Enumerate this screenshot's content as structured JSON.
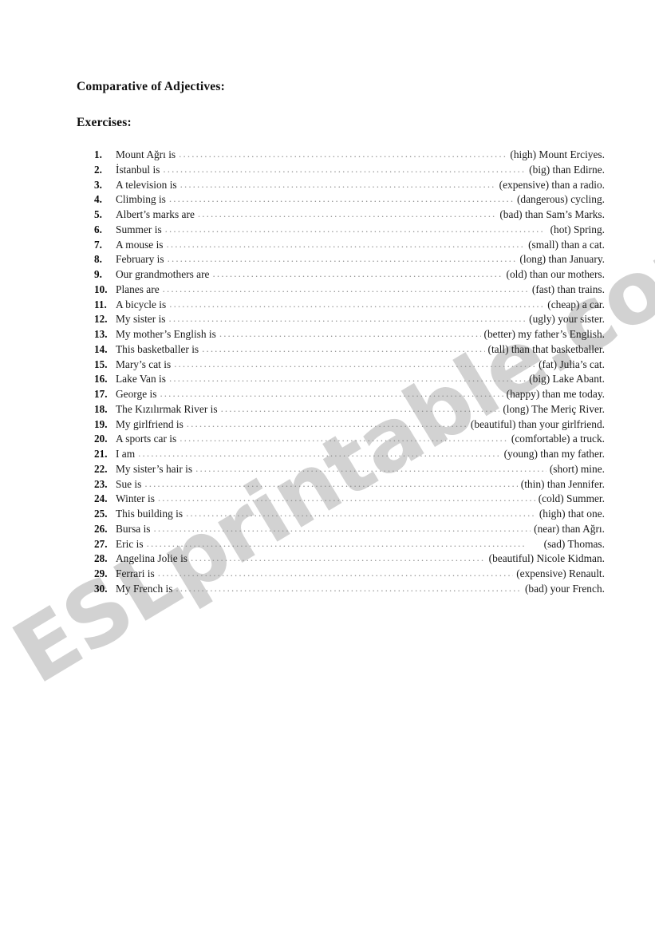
{
  "document": {
    "title_heading": "Comparative of Adjectives:",
    "exercises_heading": "Exercises:",
    "watermark": "ESLprintable.com",
    "watermark_color": "#d2d2d2",
    "page_background": "#ffffff",
    "text_color": "#1a1a1a"
  },
  "exercises": [
    {
      "number": "1.",
      "prompt": "Mount Ağrı is",
      "answer": "(high) Mount Erciyes."
    },
    {
      "number": "2.",
      "prompt": "İstanbul is",
      "answer": "(big) than Edirne."
    },
    {
      "number": "3.",
      "prompt": "A television is",
      "answer": "(expensive) than a radio."
    },
    {
      "number": "4.",
      "prompt": "Climbing is",
      "answer": "(dangerous) cycling."
    },
    {
      "number": "5.",
      "prompt": "Albert’s marks are",
      "answer": "(bad) than Sam’s Marks."
    },
    {
      "number": "6.",
      "prompt": "Summer is",
      "answer": "(hot) Spring."
    },
    {
      "number": "7.",
      "prompt": "A mouse is",
      "answer": "(small) than a cat."
    },
    {
      "number": "8.",
      "prompt": "February is",
      "answer": "(long) than January."
    },
    {
      "number": "9.",
      "prompt": "Our grandmothers are",
      "answer": "(old) than our mothers."
    },
    {
      "number": "10.",
      "prompt": "Planes are",
      "answer": "(fast) than trains."
    },
    {
      "number": "11.",
      "prompt": "A bicycle is",
      "answer": "(cheap) a car."
    },
    {
      "number": "12.",
      "prompt": "My sister is",
      "answer": "(ugly) your sister."
    },
    {
      "number": "13.",
      "prompt": "My mother’s English is",
      "answer": "(better) my father’s English."
    },
    {
      "number": "14.",
      "prompt": "This basketballer is",
      "answer": "(tall) than that basketballer."
    },
    {
      "number": "15.",
      "prompt": "Mary’s cat is",
      "answer": "(fat) Julia’s cat."
    },
    {
      "number": "16.",
      "prompt": "Lake Van is",
      "answer": "(big) Lake Abant."
    },
    {
      "number": "17.",
      "prompt": "George is",
      "answer": "(happy) than me today."
    },
    {
      "number": "18.",
      "prompt": "The Kızılırmak River is",
      "answer": "(long) The Meriç River."
    },
    {
      "number": "19.",
      "prompt": "My girlfriend is",
      "answer": "(beautiful) than your girlfriend."
    },
    {
      "number": "20.",
      "prompt": "A sports car is",
      "answer": "(comfortable) a truck."
    },
    {
      "number": "21.",
      "prompt": "I am",
      "answer": "(young) than my father."
    },
    {
      "number": "22.",
      "prompt": "My sister’s hair is",
      "answer": "(short) mine."
    },
    {
      "number": "23.",
      "prompt": "Sue is",
      "answer": "(thin) than Jennifer."
    },
    {
      "number": "24.",
      "prompt": "Winter is",
      "answer": "(cold) Summer."
    },
    {
      "number": "25.",
      "prompt": "This building is",
      "answer": "(high) that one."
    },
    {
      "number": "26.",
      "prompt": "Bursa is",
      "answer": "(near) than Ağrı."
    },
    {
      "number": "27.",
      "prompt": "Eric is",
      "answer": "(sad) Thomas."
    },
    {
      "number": "28.",
      "prompt": "Angelina Jolie is",
      "answer": "(beautiful) Nicole Kidman."
    },
    {
      "number": "29.",
      "prompt": "Ferrari is",
      "answer": "(expensive) Renault."
    },
    {
      "number": "30.",
      "prompt": "My French is",
      "answer": "(bad) your French."
    }
  ]
}
